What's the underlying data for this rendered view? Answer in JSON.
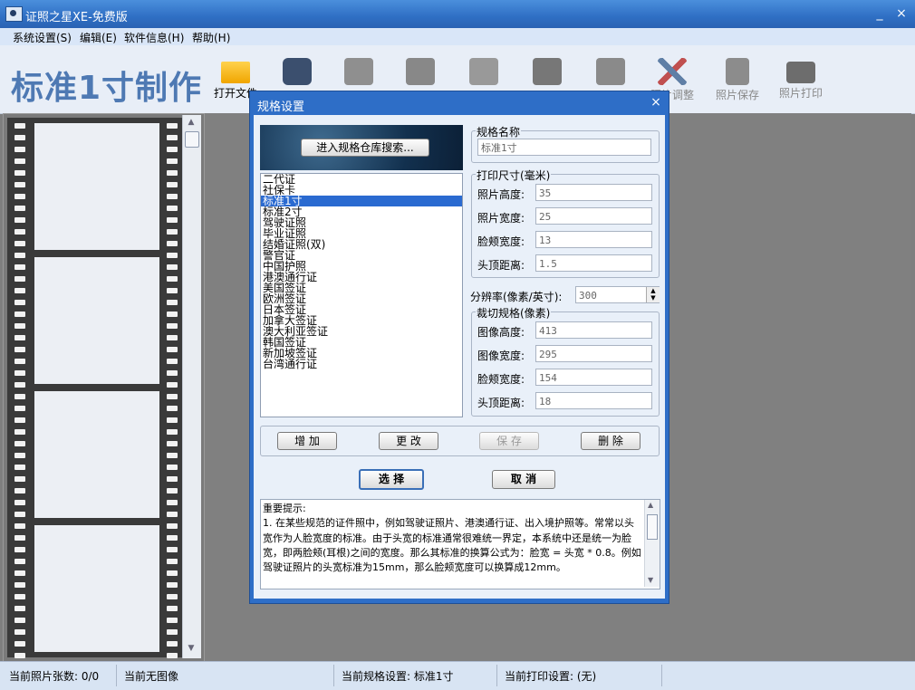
{
  "window": {
    "title": "证照之星XE-免费版",
    "minimize": "_",
    "close": "×"
  },
  "menu": [
    {
      "label": "系统设置(S)"
    },
    {
      "label": "编辑(E)"
    },
    {
      "label": "软件信息(H)"
    },
    {
      "label": "帮助(H)"
    }
  ],
  "toolbar": {
    "mode_title": "标准1寸制作",
    "open_file": "打开文件",
    "photo_adjust": "照片调整",
    "photo_save": "照片保存",
    "photo_print": "照片打印",
    "accent": "#4e79b3"
  },
  "dialog": {
    "title": "规格设置",
    "close": "×",
    "warehouse_button": "进入规格仓库搜索...",
    "spec_list": [
      "二代证",
      "社保卡",
      "标准1寸",
      "标准2寸",
      "驾驶证照",
      "毕业证照",
      "结婚证照(双)",
      "警官证",
      "中国护照",
      "港澳通行证",
      "美国签证",
      "欧洲签证",
      "日本签证",
      "加拿大签证",
      "澳大利亚签证",
      "韩国签证",
      "新加坡签证",
      "台湾通行证"
    ],
    "selected_index": 2,
    "name_group": {
      "legend": "规格名称",
      "value": "标准1寸"
    },
    "print_group": {
      "legend": "打印尺寸(毫米)",
      "fields": [
        {
          "label": "照片高度:",
          "value": "35"
        },
        {
          "label": "照片宽度:",
          "value": "25"
        },
        {
          "label": "脸颊宽度:",
          "value": "13"
        },
        {
          "label": "头顶距离:",
          "value": "1.5"
        }
      ]
    },
    "dpi": {
      "label": "分辨率(像素/英寸):",
      "value": "300"
    },
    "crop_group": {
      "legend": "裁切规格(像素)",
      "fields": [
        {
          "label": "图像高度:",
          "value": "413"
        },
        {
          "label": "图像宽度:",
          "value": "295"
        },
        {
          "label": "脸颊宽度:",
          "value": "154"
        },
        {
          "label": "头顶距离:",
          "value": "18"
        }
      ]
    },
    "buttons": {
      "add": "增 加",
      "edit": "更 改",
      "save": "保 存",
      "delete": "删 除",
      "select": "选  择",
      "cancel": "取  消"
    },
    "hint": "重要提示:\n1. 在某些规范的证件照中，例如驾驶证照片、港澳通行证、出入境护照等。常常以头宽作为人脸宽度的标准。由于头宽的标准通常很难统一界定，本系统中还是统一为脸宽，即两脸颊(耳根)之间的宽度。那么其标准的换算公式为：脸宽 = 头宽 * 0.8。例如驾驶证照片的头宽标准为15mm，那么脸颊宽度可以换算成12mm。"
  },
  "status": {
    "count": "当前照片张数: 0/0",
    "image": "当前无图像",
    "spec": "当前规格设置: 标准1寸",
    "print": "当前打印设置: (无)"
  }
}
